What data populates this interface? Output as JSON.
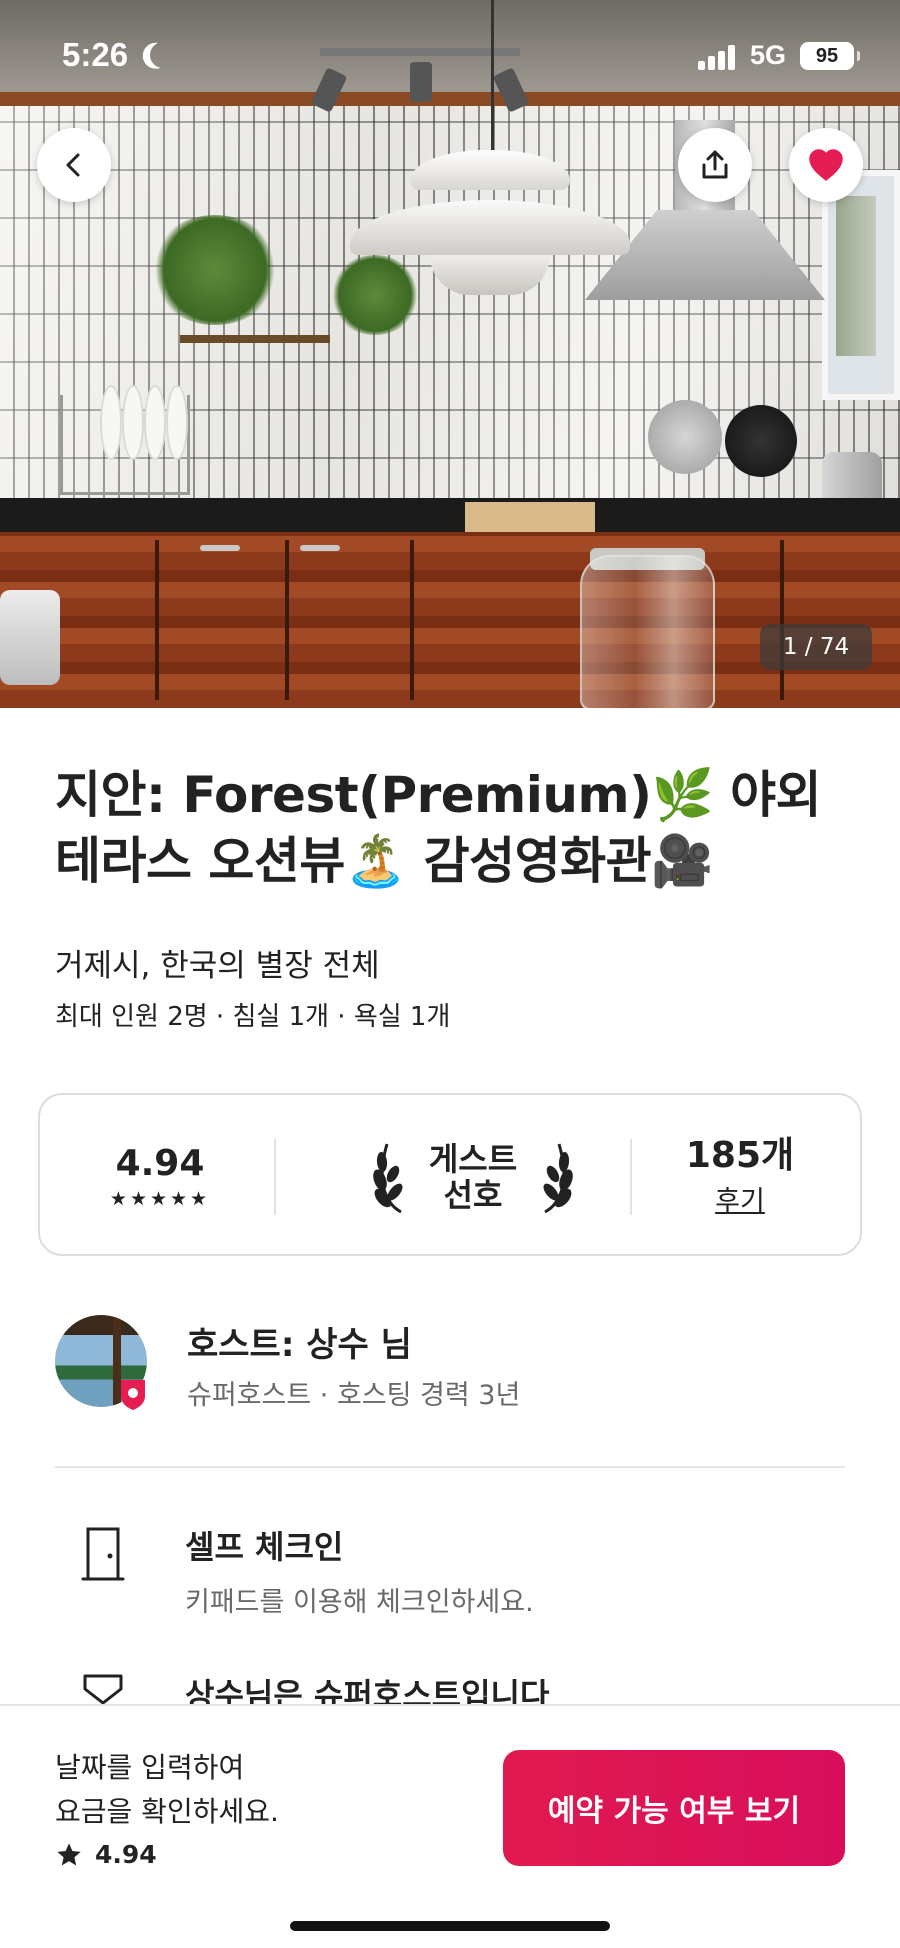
{
  "status_bar": {
    "time": "5:26",
    "network": "5G",
    "battery": "95"
  },
  "photo": {
    "counter": "1 / 74"
  },
  "buttons": {
    "back_icon": "chevron-left-icon",
    "share_icon": "share-icon",
    "favorite_icon": "heart-icon",
    "favorite_color": "#e51d53"
  },
  "listing": {
    "title": "지안: Forest(Premium)🌿 야외 테라스 오션뷰🏝️ 감성영화관🎥",
    "subtitle": "거제시, 한국의 별장 전체",
    "details": "최대 인원 2명 · 침실 1개 · 욕실 1개"
  },
  "rating_card": {
    "score": "4.94",
    "stars": "★★★★★",
    "guest_favorite_line1": "게스트",
    "guest_favorite_line2": "선호",
    "reviews_count": "185개",
    "reviews_label": "후기"
  },
  "host": {
    "name": "호스트: 상수 님",
    "meta": "슈퍼호스트 · 호스팅 경력 3년"
  },
  "features": [
    {
      "icon": "door-icon",
      "title": "셀프 체크인",
      "description": "키패드를 이용해 체크인하세요."
    },
    {
      "icon": "medal-icon",
      "title": "상수님은 슈퍼호스트입니다",
      "description": ""
    }
  ],
  "booking_bar": {
    "prompt_line1": "날짜를 입력하여",
    "prompt_line2": "요금을 확인하세요.",
    "rating": "4.94",
    "cta_label": "예약 가능 여부 보기",
    "cta_color": "#e01a4f"
  }
}
